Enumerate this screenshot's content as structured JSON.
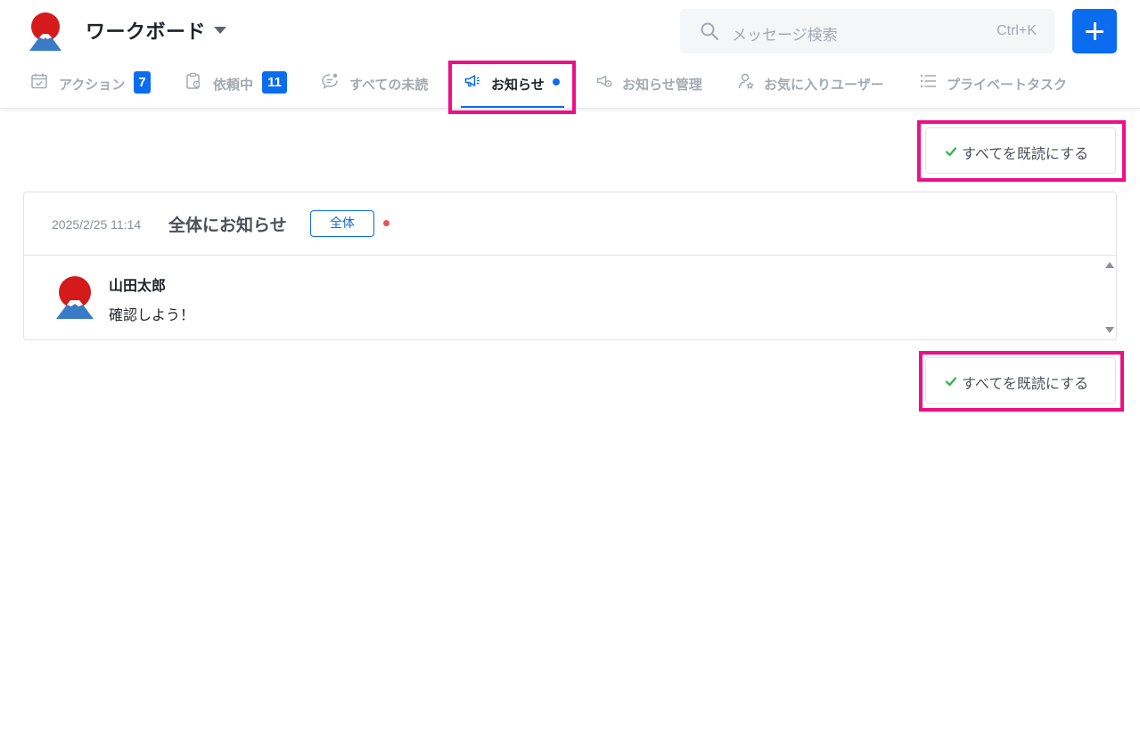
{
  "header": {
    "board_title": "ワークボード",
    "search_placeholder": "メッセージ検索",
    "search_shortcut": "Ctrl+K",
    "logo_icon": "fuji-sun-logo-icon",
    "add_icon": "plus-icon"
  },
  "tabs": [
    {
      "label": "アクション",
      "badge": "7",
      "icon": "calendar-check-icon",
      "active": false
    },
    {
      "label": "依頼中",
      "badge": "11",
      "icon": "clipboard-user-icon",
      "active": false
    },
    {
      "label": "すべての未読",
      "badge": null,
      "icon": "chat-bubble-dot-icon",
      "active": false
    },
    {
      "label": "お知らせ",
      "badge": null,
      "icon": "megaphone-icon",
      "active": true,
      "unread_dot": true
    },
    {
      "label": "お知らせ管理",
      "badge": null,
      "icon": "megaphone-gear-icon",
      "active": false
    },
    {
      "label": "お気に入りユーザー",
      "badge": null,
      "icon": "user-star-icon",
      "active": false
    },
    {
      "label": "プライベートタスク",
      "badge": null,
      "icon": "list-icon",
      "active": false
    }
  ],
  "actions": {
    "mark_all_read_top": "すべてを既読にする",
    "mark_all_read_bottom": "すべてを既読にする",
    "check_icon": "check-icon"
  },
  "announcement": {
    "date": "2025/2/25 11:14",
    "title": "全体にお知らせ",
    "tag": "全体",
    "unread": true,
    "messages": [
      {
        "author": "山田太郎",
        "text": "確認しよう！",
        "avatar": "fuji-sun-avatar-icon"
      }
    ]
  },
  "colors": {
    "accent": "#0b6cf0",
    "highlight": "#ee0f88",
    "unread_dot": "#e25555",
    "check": "#2db24a"
  }
}
